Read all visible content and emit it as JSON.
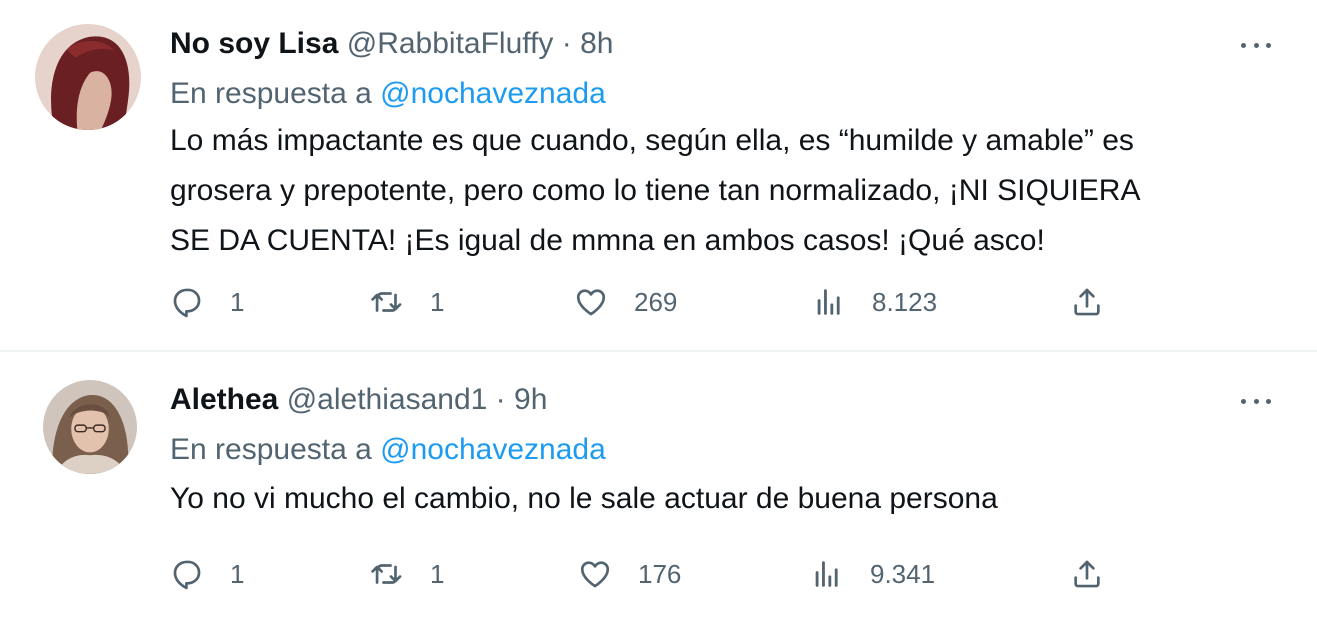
{
  "tweets": [
    {
      "author_name": "No soy Lisa",
      "handle": "@RabbitaFluffy",
      "separator": "·",
      "time": "8h",
      "reply_prefix": "En respuesta a",
      "reply_mention": "@nochaveznada",
      "text_lines": [
        "Lo más impactante es que cuando, según ella, es “humilde y amable” es",
        "grosera y prepotente, pero como lo tiene tan normalizado, ¡NI SIQUIERA",
        "SE DA CUENTA! ¡Es igual de mmna en ambos casos! ¡Qué asco!"
      ],
      "replies": "1",
      "retweets": "1",
      "likes": "269",
      "views": "8.123"
    },
    {
      "author_name": "Alethea",
      "handle": "@alethiasand1",
      "separator": "·",
      "time": "9h",
      "reply_prefix": "En respuesta a",
      "reply_mention": "@nochaveznada",
      "text_lines": [
        "Yo no vi mucho el cambio, no le sale actuar de buena persona"
      ],
      "replies": "1",
      "retweets": "1",
      "likes": "176",
      "views": "9.341"
    }
  ],
  "icons": {
    "reply": "reply-icon",
    "retweet": "retweet-icon",
    "like": "heart-icon",
    "views": "views-bar-chart-icon",
    "share": "share-icon",
    "more": "more-dots-icon"
  },
  "colors": {
    "text_primary": "#0f1419",
    "text_secondary": "#536471",
    "mention": "#1d9bf0",
    "divider": "#eff3f4"
  }
}
